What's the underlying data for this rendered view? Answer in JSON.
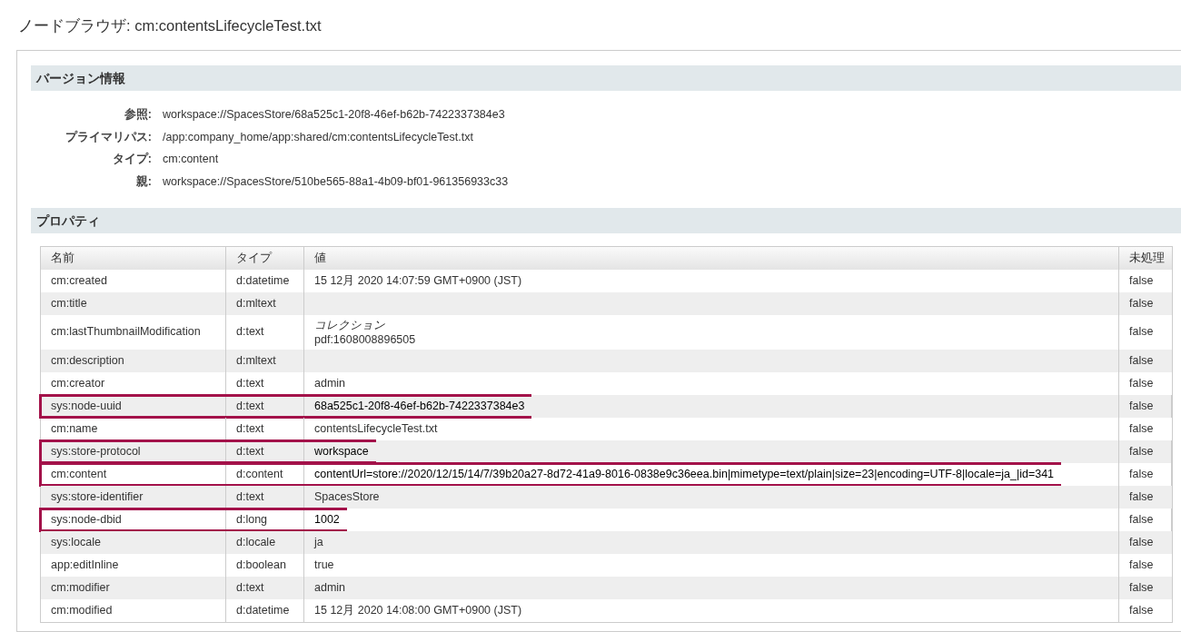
{
  "page_title": "ノードブラウザ: cm:contentsLifecycleTest.txt",
  "version_info": {
    "heading": "バージョン情報",
    "fields": [
      {
        "label": "参照:",
        "value": "workspace://SpacesStore/68a525c1-20f8-46ef-b62b-7422337384e3"
      },
      {
        "label": "プライマリパス:",
        "value": "/app:company_home/app:shared/cm:contentsLifecycleTest.txt"
      },
      {
        "label": "タイプ:",
        "value": "cm:content"
      },
      {
        "label": "親:",
        "value": "workspace://SpacesStore/510be565-88a1-4b09-bf01-961356933c33"
      }
    ]
  },
  "properties": {
    "heading": "プロパティ",
    "columns": [
      "名前",
      "タイプ",
      "値",
      "未処理"
    ],
    "rows": [
      {
        "name": "cm:created",
        "type": "d:datetime",
        "value": "15 12月 2020 14:07:59 GMT+0900 (JST)",
        "raw": "false",
        "highlighted": false
      },
      {
        "name": "cm:title",
        "type": "d:mltext",
        "value": "",
        "raw": "false",
        "highlighted": false
      },
      {
        "name": "cm:lastThumbnailModification",
        "type": "d:text",
        "value": "*コレクション*\npdf:1608008896505",
        "raw": "false",
        "highlighted": false
      },
      {
        "name": "cm:description",
        "type": "d:mltext",
        "value": "",
        "raw": "false",
        "highlighted": false
      },
      {
        "name": "cm:creator",
        "type": "d:text",
        "value": "admin",
        "raw": "false",
        "highlighted": false
      },
      {
        "name": "sys:node-uuid",
        "type": "d:text",
        "value": "68a525c1-20f8-46ef-b62b-7422337384e3",
        "raw": "false",
        "highlighted": true
      },
      {
        "name": "cm:name",
        "type": "d:text",
        "value": "contentsLifecycleTest.txt",
        "raw": "false",
        "highlighted": false
      },
      {
        "name": "sys:store-protocol",
        "type": "d:text",
        "value": "workspace",
        "raw": "false",
        "highlighted": true
      },
      {
        "name": "cm:content",
        "type": "d:content",
        "value": "contentUrl=store://2020/12/15/14/7/39b20a27-8d72-41a9-8016-0838e9c36eea.bin|mimetype=text/plain|size=23|encoding=UTF-8|locale=ja_|id=341",
        "raw": "false",
        "highlighted": true
      },
      {
        "name": "sys:store-identifier",
        "type": "d:text",
        "value": "SpacesStore",
        "raw": "false",
        "highlighted": false
      },
      {
        "name": "sys:node-dbid",
        "type": "d:long",
        "value": "1002",
        "raw": "false",
        "highlighted": true
      },
      {
        "name": "sys:locale",
        "type": "d:locale",
        "value": "ja",
        "raw": "false",
        "highlighted": false
      },
      {
        "name": "app:editInline",
        "type": "d:boolean",
        "value": "true",
        "raw": "false",
        "highlighted": false
      },
      {
        "name": "cm:modifier",
        "type": "d:text",
        "value": "admin",
        "raw": "false",
        "highlighted": false
      },
      {
        "name": "cm:modified",
        "type": "d:datetime",
        "value": "15 12月 2020 14:08:00 GMT+0900 (JST)",
        "raw": "false",
        "highlighted": false
      }
    ]
  }
}
